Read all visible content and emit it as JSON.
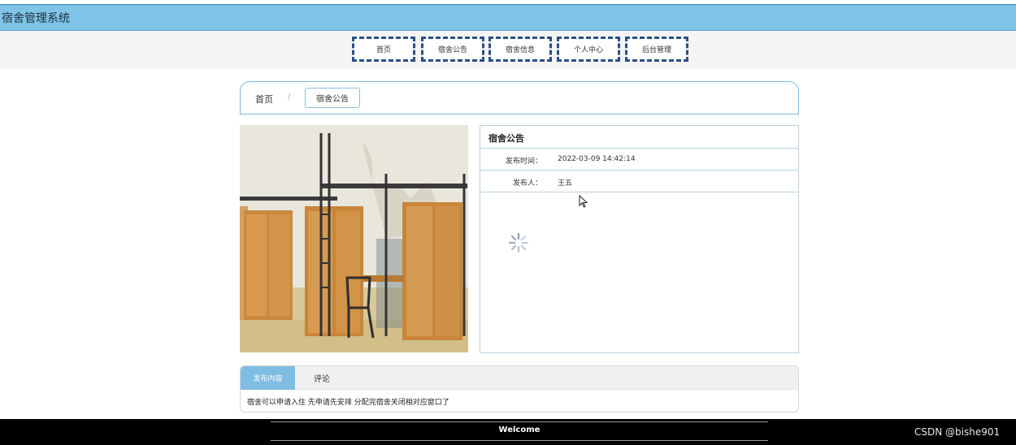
{
  "app": {
    "title": "宿舍管理系统"
  },
  "nav": [
    "首页",
    "宿舍公告",
    "宿舍信息",
    "个人中心",
    "后台管理"
  ],
  "breadcrumb": {
    "home": "首页",
    "separator": "/",
    "current": "宿舍公告"
  },
  "notice": {
    "title": "宿舍公告",
    "time_label": "发布时间：",
    "time_value": "2022-03-09 14:42:14",
    "author_label": "发布人：",
    "author_value": "王五"
  },
  "tabs": {
    "active": "发布内容",
    "other": "评论",
    "content": "宿舍可以申请入住 先申请先安排 分配完宿舍关闭相对应窗口了"
  },
  "footer": {
    "welcome": "Welcome",
    "watermark": "CSDN @bishe901"
  },
  "colors": {
    "topbar": "#7fc4e6",
    "nav_border": "#2a4f86",
    "tab_active": "#7fbde3",
    "footer": "#000000"
  }
}
